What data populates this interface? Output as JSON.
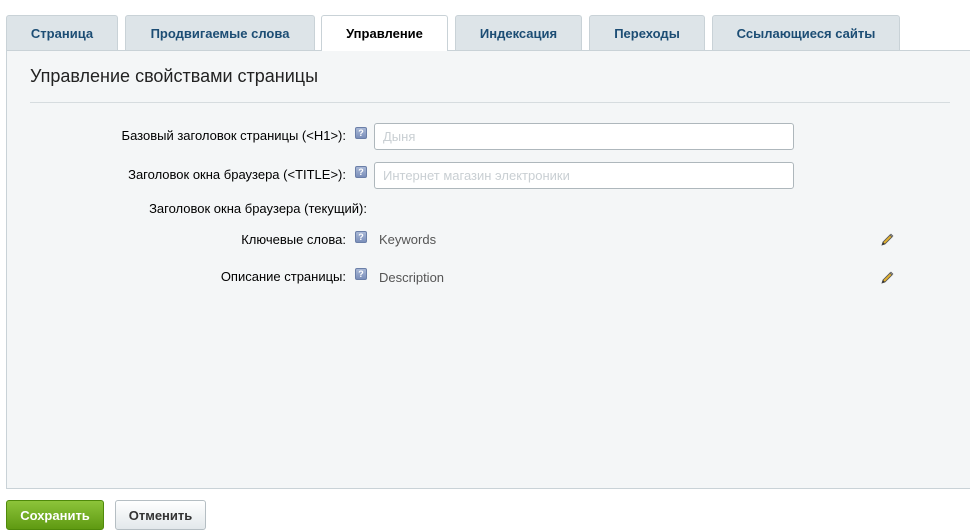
{
  "tabs": [
    {
      "label": "Страница"
    },
    {
      "label": "Продвигаемые слова"
    },
    {
      "label": "Управление"
    },
    {
      "label": "Индексация"
    },
    {
      "label": "Переходы"
    },
    {
      "label": "Ссылающиеся сайты"
    }
  ],
  "active_tab": "Управление",
  "panel": {
    "title": "Управление свойствами страницы",
    "fields": {
      "h1": {
        "label": "Базовый заголовок страницы (<H1>):",
        "value": "Дыня"
      },
      "title": {
        "label": "Заголовок окна браузера (<TITLE>):",
        "value": "Интернет магазин электроники"
      },
      "current_title": {
        "label": "Заголовок окна браузера (текущий):"
      },
      "keywords": {
        "label": "Ключевые слова:",
        "value": "Keywords"
      },
      "description": {
        "label": "Описание страницы:",
        "value": "Description"
      }
    },
    "help_glyph": "?"
  },
  "buttons": {
    "save": "Сохранить",
    "cancel": "Отменить"
  },
  "colors": {
    "save_button": "#6fae1d",
    "tab_text": "#1c4d74",
    "panel_bg": "#f4f6f7"
  }
}
